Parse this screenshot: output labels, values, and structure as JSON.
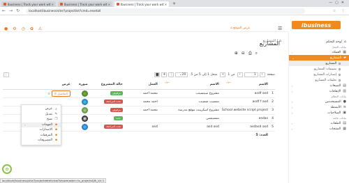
{
  "browser": {
    "tabs": [
      {
        "label": "Ibusiness | Track your work wit"
      },
      {
        "label": "Ibusiness | Track your work wit"
      },
      {
        "label": "Ibusiness | Track your work wit"
      }
    ],
    "url": "localhost/ibusiness/site/?projectlist?cmd=resetall"
  },
  "header": {
    "show_site": "عرض الموقع",
    "logo": "ibusiness"
  },
  "sidebar": {
    "dashboard": "لوحة التحكم",
    "work_data_head": "بيانات العمل",
    "clients": "العملاء",
    "projects": "المشاريع",
    "sub": [
      "المشاريع",
      "تصنيفات المشاريع",
      "إصدارات المشاريع",
      "تعليقات المشاريع"
    ],
    "sales": "المبيعات",
    "expenses": "الإنفاقات",
    "settings_head": "بيانات النظام",
    "users": "المستخدمين",
    "activities": "الأنشطة",
    "permissions": "الصلاحيات",
    "data_head": "بيانات عامة",
    "attachments": "الملفات",
    "products": "المنتجات"
  },
  "page": {
    "breadcrumb": "المشاريع",
    "title": "المشاريع"
  },
  "toolbar": {
    "page_label": "صفحة",
    "page_num": "1",
    "of_pages": "من 1",
    "records": "سجل 1 إلى 5 من 5",
    "per_page": "20"
  },
  "table": {
    "headers": [
      "الاسم",
      "الاسم",
      "العمل",
      "حالة المشروع",
      "صورة",
      "عرض"
    ],
    "header_subs": [
      "عنوان",
      "عنوان"
    ],
    "rows": [
      {
        "num": "1",
        "name": "asdf asd",
        "title": "مشروع سيتسيتب",
        "client": "محمد احمد",
        "status": "مرفوض",
        "status_color": "#5cb85c"
      },
      {
        "num": "2",
        "name": "asdf f asd",
        "title": "شسيب شسيب",
        "client": "احمد محمد",
        "status": "تحت المراجعة",
        "status_color": "#d9534f"
      },
      {
        "num": "3",
        "name": "School website script project",
        "title": "مشروع اسكريبت موقع مدرسة",
        "client": "محمد احمد",
        "status": "مرفوض",
        "status_color": "#d9534f"
      },
      {
        "num": "4",
        "name": "asdas",
        "title": "شسيتسي",
        "client": "",
        "status": "جديد",
        "status_color": "#5cb85c"
      },
      {
        "num": "5",
        "name": "asdasd asd",
        "title": "asd asd",
        "client": "asd",
        "status": "تحت المراجعة",
        "status_color": "#d9534f"
      }
    ],
    "total": "العدد: 5",
    "details_btn": "التفاصيل"
  },
  "menu": {
    "items": [
      "عرض",
      "تعديل",
      "نسخ",
      "المهمات",
      "الاصدارات",
      "المرفقات",
      "المصروفات"
    ]
  },
  "statusbar": "localhost/ibusiness/site/?projectdeteilview?showmaster=ts_projects&fk_id=1"
}
